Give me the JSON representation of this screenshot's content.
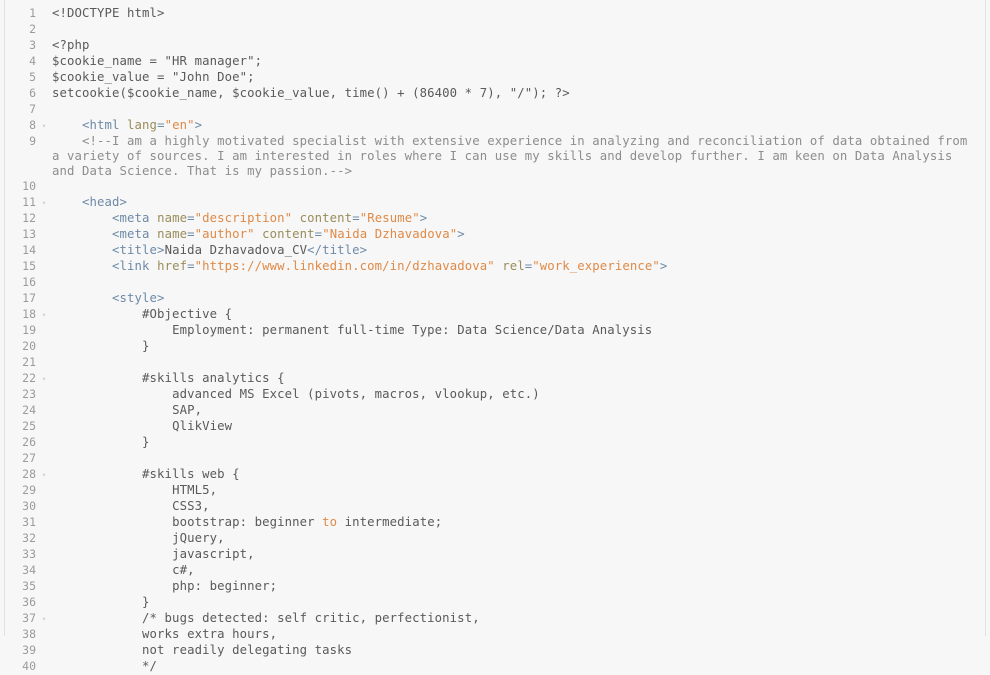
{
  "editor": {
    "name": "code-editor",
    "background_color": "#f7f7f7",
    "plain_text_color": "#5a5a5a",
    "gutter_color": "#9b9b9b",
    "fold_marker_color": "#c9c9c9",
    "fold_marker_glyph": "▾",
    "colors": {
      "tag": "#6d8aa8",
      "attribute": "#9a8c5a",
      "string": "#e08a46",
      "keyword": "#e08a46",
      "comment": "#8d8d8d",
      "plain": "#5a5a5a"
    },
    "first_line_number": 1,
    "last_line_number": 40,
    "total_visible_lines": 40
  },
  "lines": [
    {
      "num": "1",
      "fold": false,
      "tokens": [
        {
          "c": "plain",
          "t": "<!DOCTYPE html>"
        }
      ]
    },
    {
      "num": "2",
      "fold": false,
      "tokens": [
        {
          "c": "plain",
          "t": ""
        }
      ]
    },
    {
      "num": "3",
      "fold": false,
      "tokens": [
        {
          "c": "plain",
          "t": "<?php"
        }
      ]
    },
    {
      "num": "4",
      "fold": false,
      "tokens": [
        {
          "c": "plain",
          "t": "$cookie_name = \"HR manager\";"
        }
      ]
    },
    {
      "num": "5",
      "fold": false,
      "tokens": [
        {
          "c": "plain",
          "t": "$cookie_value = \"John Doe\";"
        }
      ]
    },
    {
      "num": "6",
      "fold": false,
      "tokens": [
        {
          "c": "plain",
          "t": "setcookie($cookie_name, $cookie_value, time() + (86400 * 7), \"/\"); ?>"
        }
      ]
    },
    {
      "num": "7",
      "fold": false,
      "tokens": [
        {
          "c": "plain",
          "t": ""
        }
      ]
    },
    {
      "num": "8",
      "fold": true,
      "tokens": [
        {
          "c": "plain",
          "t": "    "
        },
        {
          "c": "tag",
          "t": "<html "
        },
        {
          "c": "attr",
          "t": "lang"
        },
        {
          "c": "tag",
          "t": "="
        },
        {
          "c": "string",
          "t": "\"en\""
        },
        {
          "c": "tag",
          "t": ">"
        }
      ]
    },
    {
      "num": "9",
      "fold": false,
      "tokens": [
        {
          "c": "plain",
          "t": "    "
        },
        {
          "c": "comment",
          "t": "<!--I am a highly motivated specialist with extensive experience in analyzing and reconciliation of data obtained from a variety of sources. I am interested in roles where I can use my skills and develop further. I am keen on Data Analysis and Data Science. That is my passion.-->"
        }
      ]
    },
    {
      "num": "10",
      "fold": false,
      "tokens": [
        {
          "c": "plain",
          "t": ""
        }
      ]
    },
    {
      "num": "11",
      "fold": true,
      "tokens": [
        {
          "c": "plain",
          "t": "    "
        },
        {
          "c": "tag",
          "t": "<head>"
        }
      ]
    },
    {
      "num": "12",
      "fold": false,
      "tokens": [
        {
          "c": "plain",
          "t": "        "
        },
        {
          "c": "tag",
          "t": "<meta "
        },
        {
          "c": "attr",
          "t": "name"
        },
        {
          "c": "tag",
          "t": "="
        },
        {
          "c": "string",
          "t": "\"description\""
        },
        {
          "c": "tag",
          "t": " "
        },
        {
          "c": "attr",
          "t": "content"
        },
        {
          "c": "tag",
          "t": "="
        },
        {
          "c": "string",
          "t": "\"Resume\""
        },
        {
          "c": "tag",
          "t": ">"
        }
      ]
    },
    {
      "num": "13",
      "fold": false,
      "tokens": [
        {
          "c": "plain",
          "t": "        "
        },
        {
          "c": "tag",
          "t": "<meta "
        },
        {
          "c": "attr",
          "t": "name"
        },
        {
          "c": "tag",
          "t": "="
        },
        {
          "c": "string",
          "t": "\"author\""
        },
        {
          "c": "tag",
          "t": " "
        },
        {
          "c": "attr",
          "t": "content"
        },
        {
          "c": "tag",
          "t": "="
        },
        {
          "c": "string",
          "t": "\"Naida Dzhavadova\""
        },
        {
          "c": "tag",
          "t": ">"
        }
      ]
    },
    {
      "num": "14",
      "fold": false,
      "tokens": [
        {
          "c": "plain",
          "t": "        "
        },
        {
          "c": "tag",
          "t": "<title>"
        },
        {
          "c": "plain",
          "t": "Naida Dzhavadova_CV"
        },
        {
          "c": "tag",
          "t": "</title>"
        }
      ]
    },
    {
      "num": "15",
      "fold": false,
      "tokens": [
        {
          "c": "plain",
          "t": "        "
        },
        {
          "c": "tag",
          "t": "<link "
        },
        {
          "c": "attr",
          "t": "href"
        },
        {
          "c": "tag",
          "t": "="
        },
        {
          "c": "string",
          "t": "\"https://www.linkedin.com/in/dzhavadova\""
        },
        {
          "c": "tag",
          "t": " "
        },
        {
          "c": "attr",
          "t": "rel"
        },
        {
          "c": "tag",
          "t": "="
        },
        {
          "c": "string",
          "t": "\"work_experience\""
        },
        {
          "c": "tag",
          "t": ">"
        }
      ]
    },
    {
      "num": "16",
      "fold": false,
      "tokens": [
        {
          "c": "plain",
          "t": ""
        }
      ]
    },
    {
      "num": "17",
      "fold": false,
      "tokens": [
        {
          "c": "plain",
          "t": "        "
        },
        {
          "c": "tag",
          "t": "<style>"
        }
      ]
    },
    {
      "num": "18",
      "fold": true,
      "tokens": [
        {
          "c": "plain",
          "t": "            #Objective {"
        }
      ]
    },
    {
      "num": "19",
      "fold": false,
      "tokens": [
        {
          "c": "plain",
          "t": "                Employment: permanent full-time Type: Data Science/Data Analysis"
        }
      ]
    },
    {
      "num": "20",
      "fold": false,
      "tokens": [
        {
          "c": "plain",
          "t": "            }"
        }
      ]
    },
    {
      "num": "21",
      "fold": false,
      "tokens": [
        {
          "c": "plain",
          "t": ""
        }
      ]
    },
    {
      "num": "22",
      "fold": true,
      "tokens": [
        {
          "c": "plain",
          "t": "            #skills analytics {"
        }
      ]
    },
    {
      "num": "23",
      "fold": false,
      "tokens": [
        {
          "c": "plain",
          "t": "                advanced MS Excel (pivots, macros, vlookup, etc.)"
        }
      ]
    },
    {
      "num": "24",
      "fold": false,
      "tokens": [
        {
          "c": "plain",
          "t": "                SAP,"
        }
      ]
    },
    {
      "num": "25",
      "fold": false,
      "tokens": [
        {
          "c": "plain",
          "t": "                QlikView"
        }
      ]
    },
    {
      "num": "26",
      "fold": false,
      "tokens": [
        {
          "c": "plain",
          "t": "            }"
        }
      ]
    },
    {
      "num": "27",
      "fold": false,
      "tokens": [
        {
          "c": "plain",
          "t": ""
        }
      ]
    },
    {
      "num": "28",
      "fold": true,
      "tokens": [
        {
          "c": "plain",
          "t": "            #skills web {"
        }
      ]
    },
    {
      "num": "29",
      "fold": false,
      "tokens": [
        {
          "c": "plain",
          "t": "                HTML5,"
        }
      ]
    },
    {
      "num": "30",
      "fold": false,
      "tokens": [
        {
          "c": "plain",
          "t": "                CSS3,"
        }
      ]
    },
    {
      "num": "31",
      "fold": false,
      "tokens": [
        {
          "c": "plain",
          "t": "                bootstrap: beginner "
        },
        {
          "c": "keyword",
          "t": "to"
        },
        {
          "c": "plain",
          "t": " intermediate;"
        }
      ]
    },
    {
      "num": "32",
      "fold": false,
      "tokens": [
        {
          "c": "plain",
          "t": "                jQuery,"
        }
      ]
    },
    {
      "num": "33",
      "fold": false,
      "tokens": [
        {
          "c": "plain",
          "t": "                javascript,"
        }
      ]
    },
    {
      "num": "34",
      "fold": false,
      "tokens": [
        {
          "c": "plain",
          "t": "                c#,"
        }
      ]
    },
    {
      "num": "35",
      "fold": false,
      "tokens": [
        {
          "c": "plain",
          "t": "                php: beginner;"
        }
      ]
    },
    {
      "num": "36",
      "fold": false,
      "tokens": [
        {
          "c": "plain",
          "t": "            }"
        }
      ]
    },
    {
      "num": "37",
      "fold": true,
      "tokens": [
        {
          "c": "plain",
          "t": "            /* bugs detected: self critic, perfectionist,"
        }
      ]
    },
    {
      "num": "38",
      "fold": false,
      "tokens": [
        {
          "c": "plain",
          "t": "            works extra hours,"
        }
      ]
    },
    {
      "num": "39",
      "fold": false,
      "tokens": [
        {
          "c": "plain",
          "t": "            not readily delegating tasks"
        }
      ]
    },
    {
      "num": "40",
      "fold": false,
      "tokens": [
        {
          "c": "plain",
          "t": "            */"
        }
      ]
    }
  ]
}
